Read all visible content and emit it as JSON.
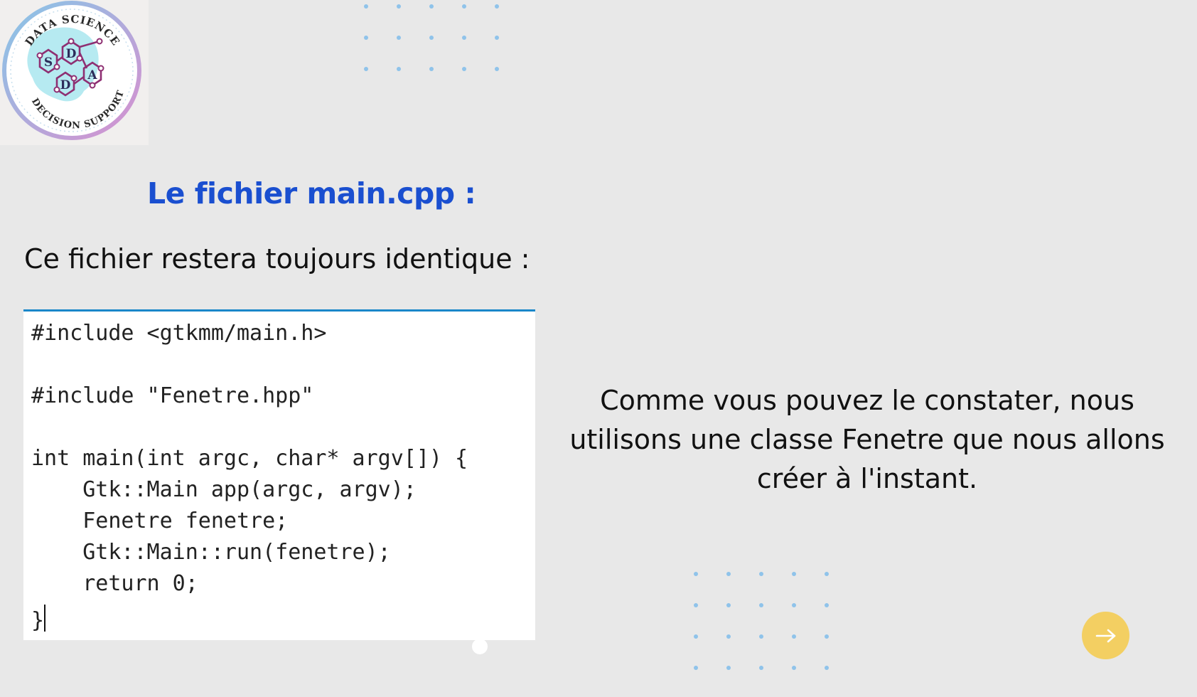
{
  "logo": {
    "top_text": "DATA SCIENCE",
    "bottom_text": "DECISION SUPPORT",
    "letters": [
      "S",
      "D",
      "A",
      "D"
    ]
  },
  "slide": {
    "title": "Le fichier main.cpp :",
    "subtitle": "Ce fichier restera toujours identique :",
    "code_lines": [
      "#include <gtkmm/main.h>",
      "",
      "#include \"Fenetre.hpp\"",
      "",
      "int main(int argc, char* argv[]) {",
      "    Gtk::Main app(argc, argv);",
      "    Fenetre fenetre;",
      "    Gtk::Main::run(fenetre);",
      "    return 0;",
      "}"
    ],
    "description_lines": [
      "Comme vous pouvez le constater, nous",
      "utilisons une classe Fenetre que nous allons",
      "créer à l'instant."
    ]
  },
  "navigation": {
    "next_icon": "arrow-right-icon"
  },
  "colors": {
    "background": "#e8e8e8",
    "title": "#1a4fd0",
    "dots": "#8fc3ea",
    "code_border": "#1a87c9",
    "next_button": "#f3cf62"
  }
}
